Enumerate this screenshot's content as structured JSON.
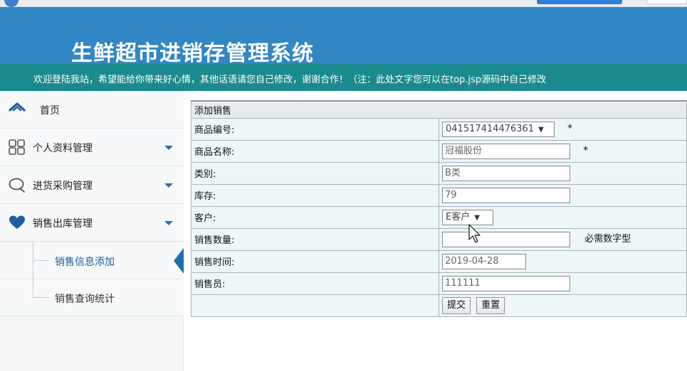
{
  "header": {
    "title": "生鲜超市进销存管理系统",
    "marquee": "欢迎登陆我站，希望能给你带来好心情，其他话语请您自己修改，谢谢合作！（注：此处文字您可以在top.jsp源码中自己修改"
  },
  "sidebar": {
    "items": [
      {
        "label": "首页",
        "icon": "home-icon"
      },
      {
        "label": "个人资料管理",
        "icon": "grid-icon"
      },
      {
        "label": "进货采购管理",
        "icon": "chat-icon"
      },
      {
        "label": "销售出库管理",
        "icon": "heart-icon"
      }
    ],
    "subitems": [
      {
        "label": "销售信息添加",
        "active": true
      },
      {
        "label": "销售查询统计",
        "active": false
      }
    ]
  },
  "form": {
    "title": "添加销售",
    "rows": [
      {
        "label": "商品编号:",
        "value": "041517414476361",
        "type": "select",
        "required": "*"
      },
      {
        "label": "商品名称:",
        "value": "冠福股份",
        "type": "input",
        "required": "*"
      },
      {
        "label": "类别:",
        "value": "B类",
        "type": "input"
      },
      {
        "label": "库存:",
        "value": "79",
        "type": "input"
      },
      {
        "label": "客户:",
        "value": "E客户",
        "type": "select"
      },
      {
        "label": "销售数量:",
        "value": "",
        "type": "input",
        "hint": "必需数字型"
      },
      {
        "label": "销售时间:",
        "value": "2019-04-28",
        "type": "input"
      },
      {
        "label": "销售员:",
        "value": "111111",
        "type": "input"
      }
    ],
    "submit_label": "提交",
    "reset_label": "重置"
  },
  "colors": {
    "header": "#3186c4",
    "marquee": "#1b8a8e",
    "accent": "#1f6db5"
  }
}
